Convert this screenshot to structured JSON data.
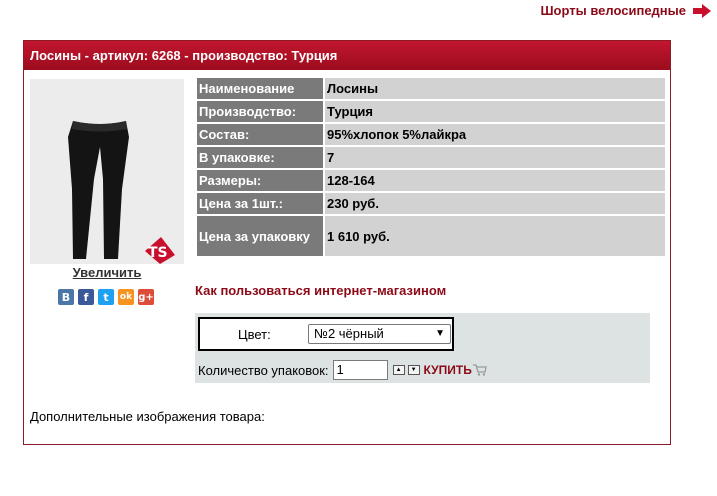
{
  "top_link": {
    "label": "Шорты велосипедные"
  },
  "product": {
    "header": "Лосины - артикул: 6268 - производство: Турция",
    "zoom_label": "Увеличить",
    "properties": [
      {
        "key": "Наименование",
        "value": "Лосины"
      },
      {
        "key": "Производство:",
        "value": "Турция"
      },
      {
        "key": "Состав:",
        "value": "95%хлопок 5%лайкра"
      },
      {
        "key": "В упаковке:",
        "value": "7"
      },
      {
        "key": "Размеры:",
        "value": "128-164"
      },
      {
        "key": "Цена за 1шт.:",
        "value": "230 руб."
      },
      {
        "key": "Цена за упаковку",
        "value": "1 610 руб."
      }
    ]
  },
  "social": {
    "vk": "В",
    "facebook": "f",
    "twitter": "t",
    "odnoklassniki": "ok",
    "googleplus": "g+"
  },
  "howto_link": "Как пользоваться интернет-магазином",
  "order": {
    "color_label": "Цвет:",
    "color_value": "№2 чёрный",
    "qty_label": "Количество упаковок:",
    "qty_value": "1",
    "buy_label": "КУПИТЬ"
  },
  "more_images_label": "Дополнительные изображения товара:",
  "colors": {
    "accent": "#8c0a18",
    "header_bg": "#b0132a",
    "key_cell": "#7a7a7a",
    "value_cell": "#d2d2d2",
    "order_bg": "#dde3e3"
  }
}
